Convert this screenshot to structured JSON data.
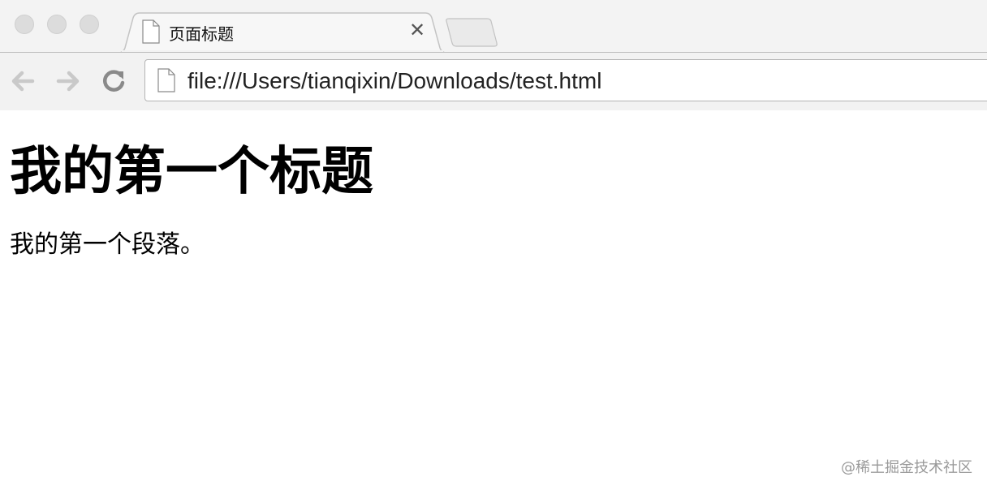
{
  "browser": {
    "tab": {
      "title": "页面标题",
      "close_glyph": "✕",
      "icon": "page-icon"
    },
    "address_bar": {
      "url": "file:///Users/tianqixin/Downloads/test.html",
      "icon": "page-icon"
    },
    "nav": {
      "back_icon": "arrow-left-icon",
      "forward_icon": "arrow-right-icon",
      "reload_icon": "reload-icon"
    }
  },
  "page": {
    "heading": "我的第一个标题",
    "paragraph": "我的第一个段落。"
  },
  "watermark": "@稀土掘金技术社区",
  "colors": {
    "chrome_bg": "#f3f3f3",
    "toolbar_bg": "#f2f2f2",
    "page_bg": "#ffffff",
    "watermark": "#9a9a9a"
  }
}
